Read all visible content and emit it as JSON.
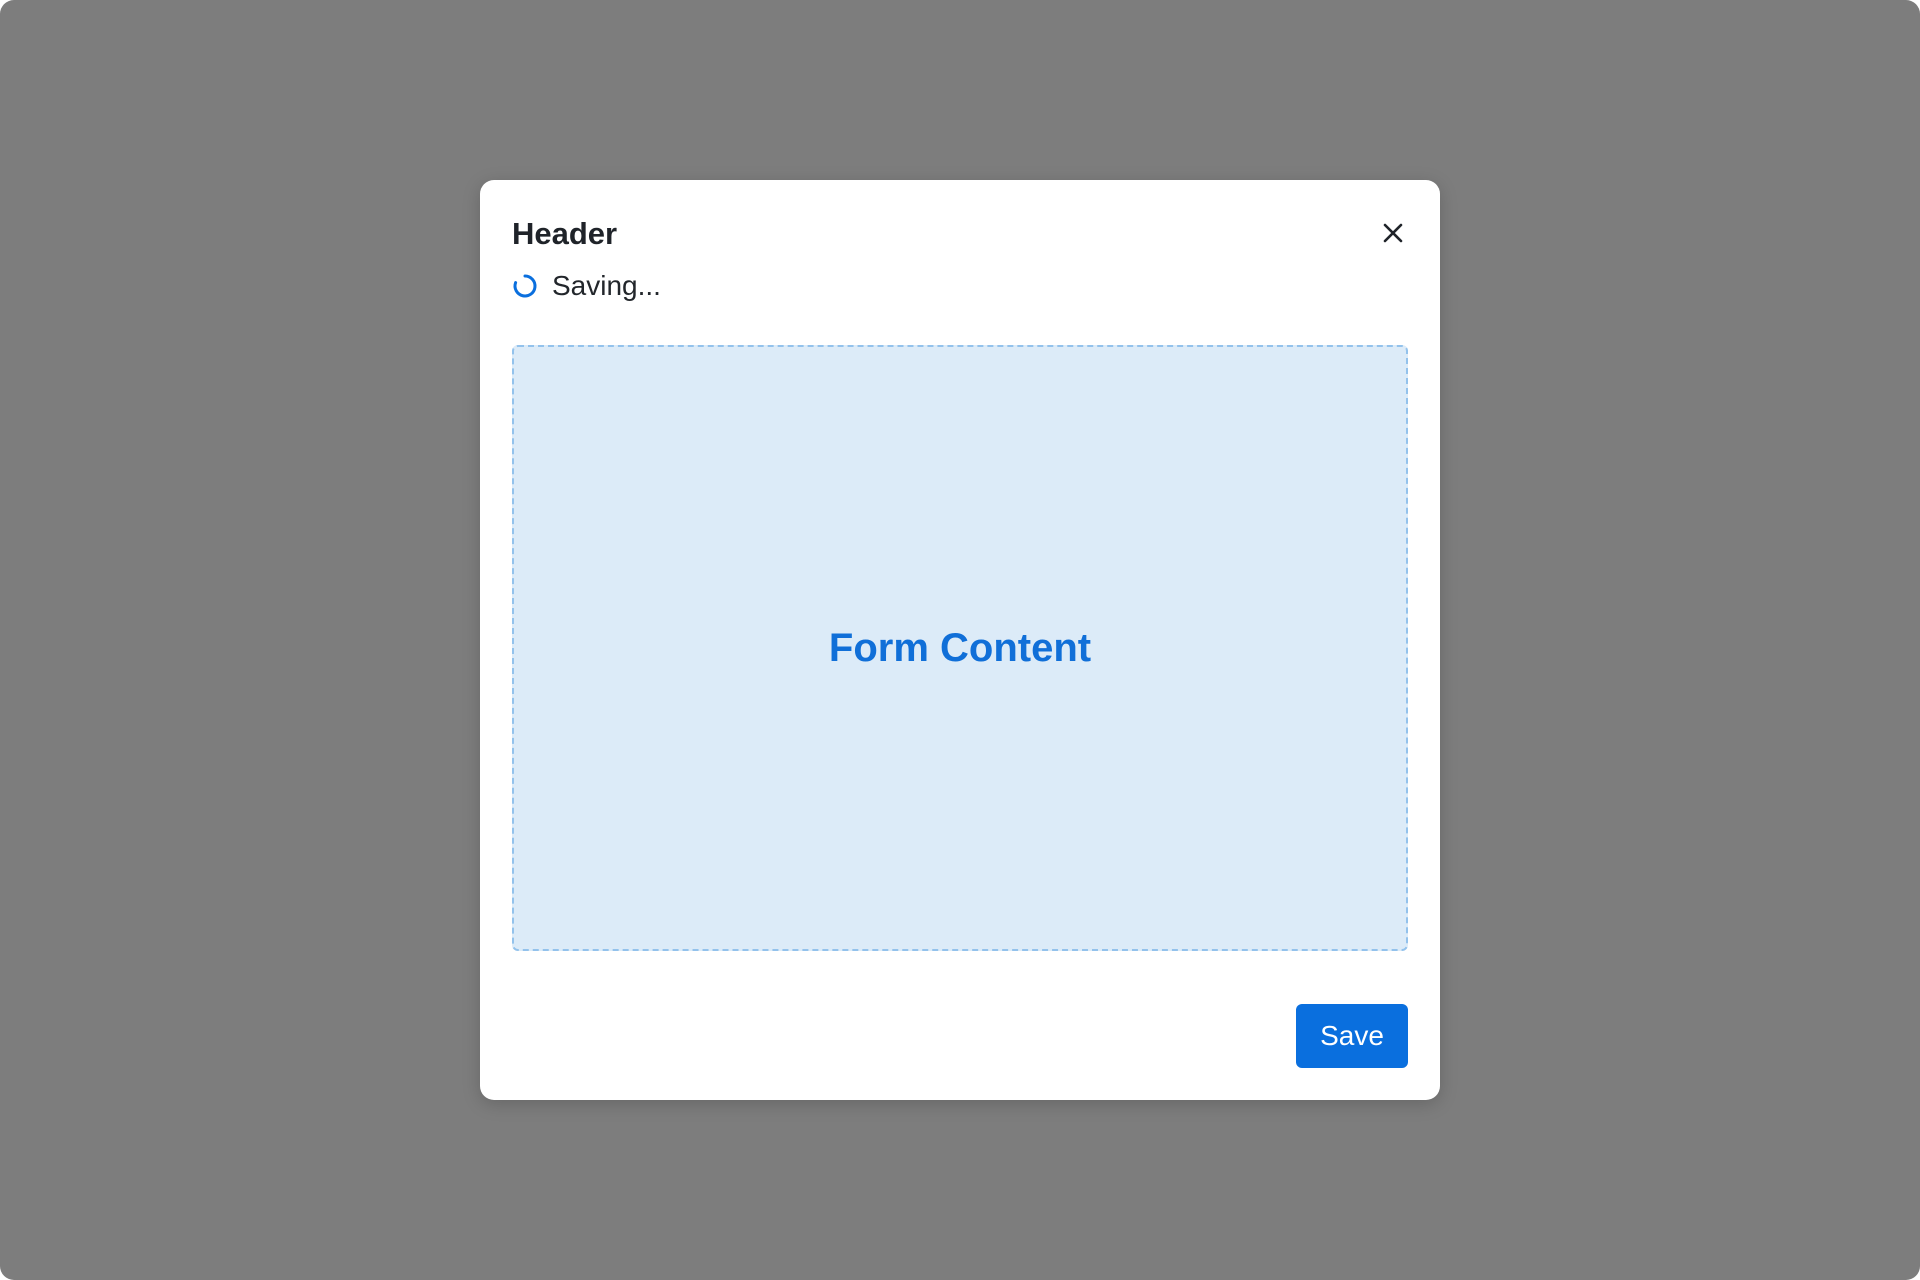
{
  "dialog": {
    "title": "Header",
    "close_icon": "close-icon",
    "status": {
      "text": "Saving...",
      "icon": "spinner-icon"
    },
    "content": {
      "label": "Form Content"
    },
    "footer": {
      "save_label": "Save"
    }
  },
  "colors": {
    "backdrop": "#7d7d7d",
    "accent": "#0a6fde",
    "content_bg": "#dcebf8",
    "content_border": "#93c2ec",
    "content_text": "#106fd8"
  }
}
